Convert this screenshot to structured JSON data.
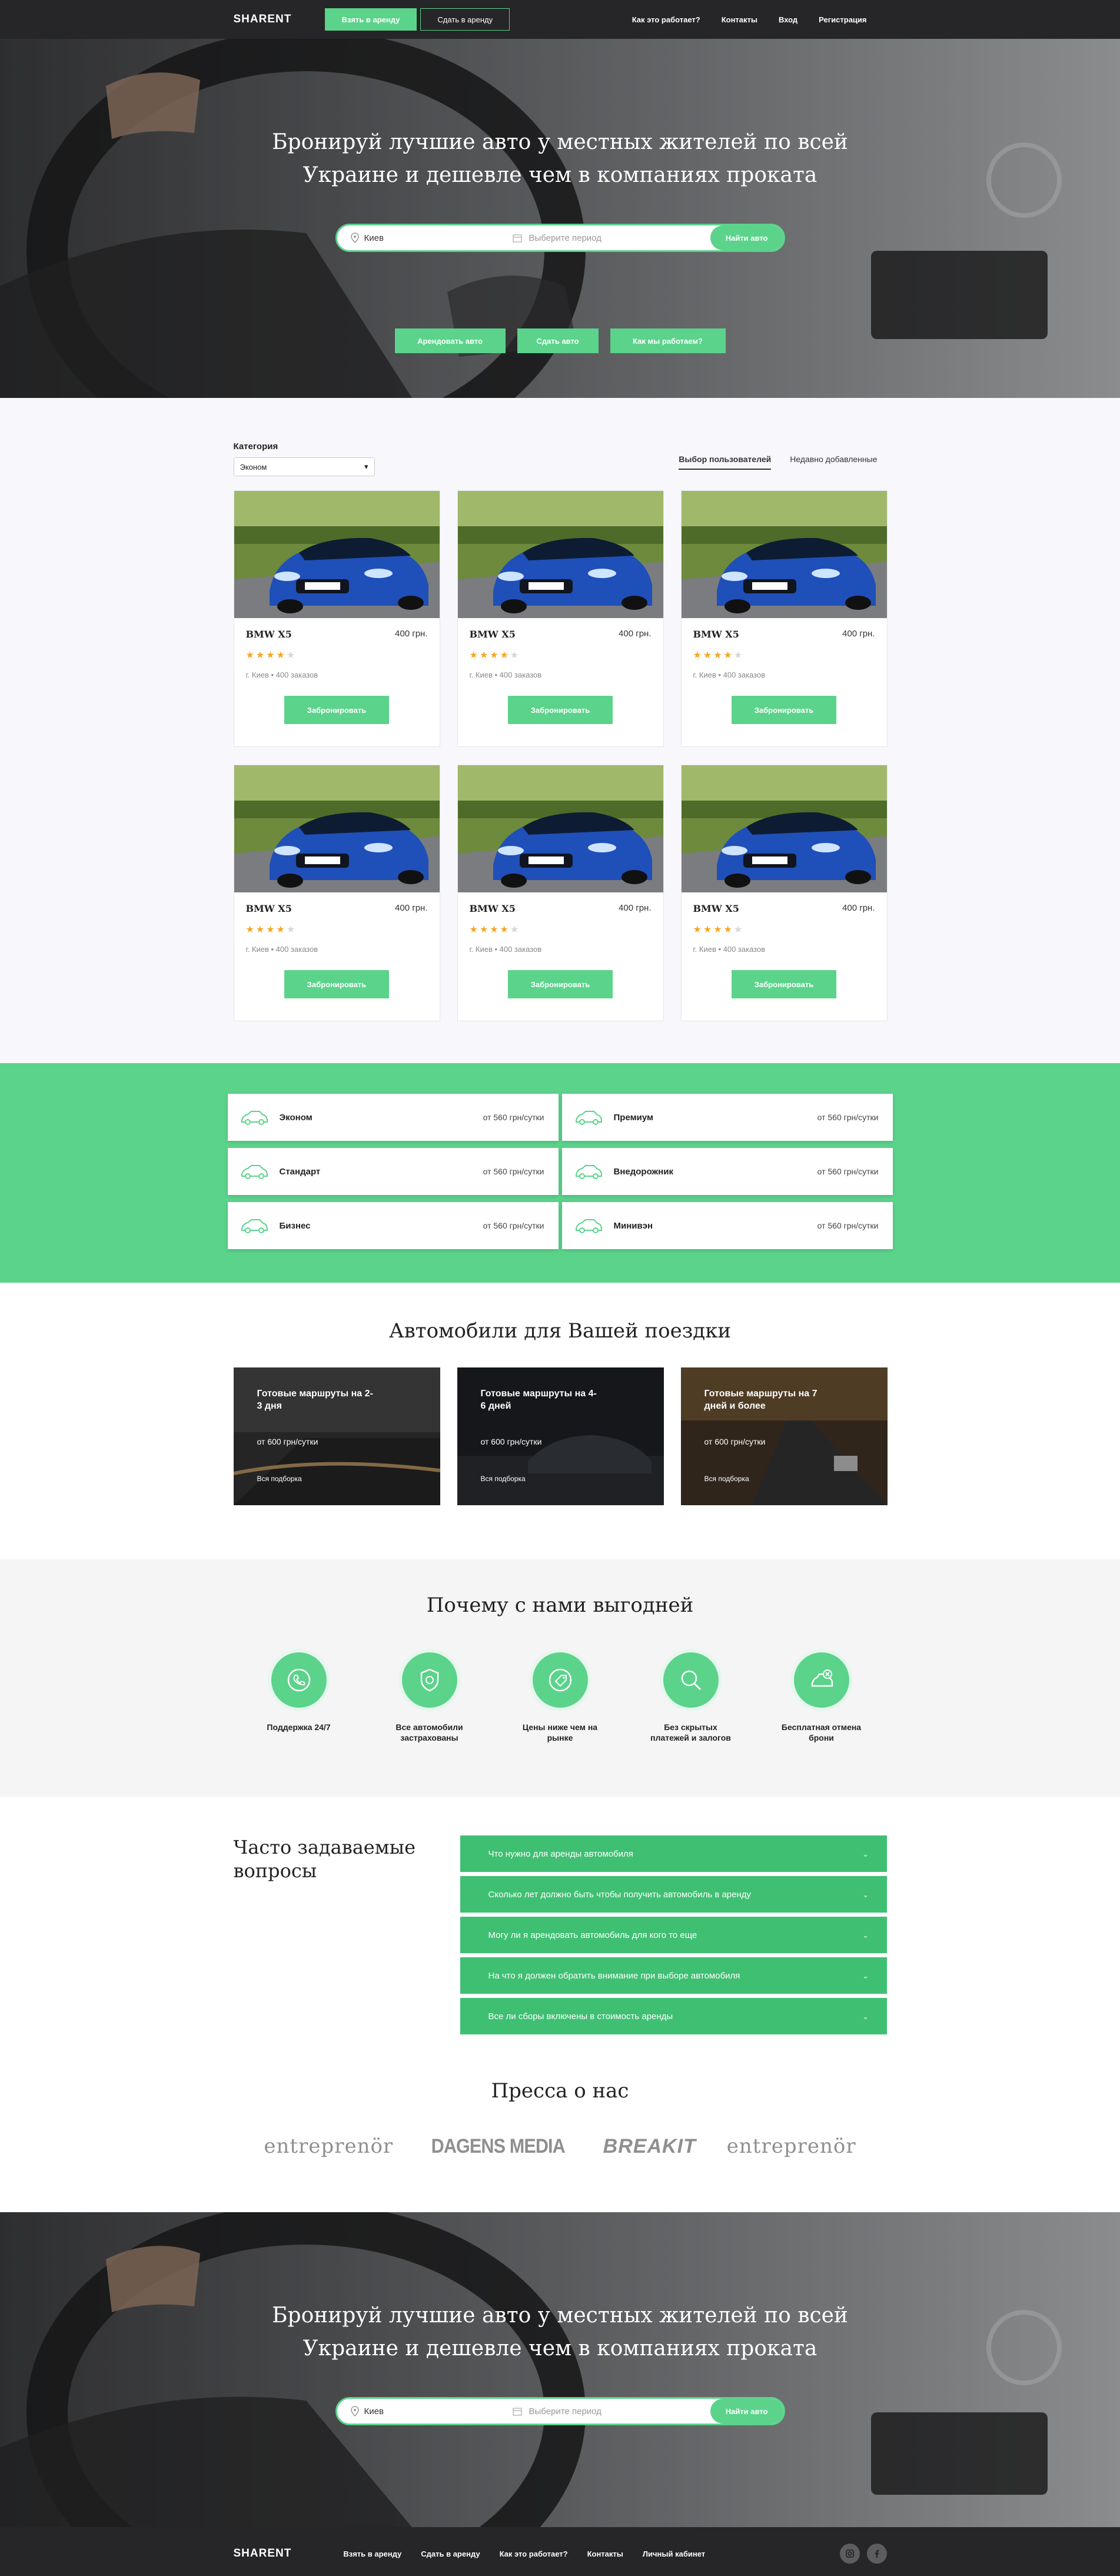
{
  "nav": {
    "logo": "SHARENT",
    "take_rent": "Взять в аренду",
    "give_rent": "Сдать в аренду",
    "links": [
      "Как это работает?",
      "Контакты",
      "Вход",
      "Регистрация"
    ]
  },
  "hero": {
    "title": "Бронируй лучшие авто у местных жителей по всей Украине и дешевле чем в компаниях проката",
    "city": "Киев",
    "period_placeholder": "Выберите период",
    "search_button": "Найти авто",
    "buttons": [
      "Арендовать авто",
      "Сдать авто",
      "Как мы работаем?"
    ]
  },
  "catalog": {
    "category_label": "Категория",
    "category_value": "Эконом",
    "tabs": [
      "Выбор пользователей",
      "Недавно добавленные"
    ],
    "cars": [
      {
        "name": "BMW X5",
        "price": "400 грн.",
        "rating": 4,
        "meta": "г. Киев • 400 заказов",
        "button": "Забронировать"
      },
      {
        "name": "BMW X5",
        "price": "400 грн.",
        "rating": 4,
        "meta": "г. Киев • 400 заказов",
        "button": "Забронировать"
      },
      {
        "name": "BMW X5",
        "price": "400 грн.",
        "rating": 4,
        "meta": "г. Киев • 400 заказов",
        "button": "Забронировать"
      },
      {
        "name": "BMW X5",
        "price": "400 грн.",
        "rating": 4,
        "meta": "г. Киев • 400 заказов",
        "button": "Забронировать"
      },
      {
        "name": "BMW X5",
        "price": "400 грн.",
        "rating": 4,
        "meta": "г. Киев • 400 заказов",
        "button": "Забронировать"
      },
      {
        "name": "BMW X5",
        "price": "400 грн.",
        "rating": 4,
        "meta": "г. Киев • 400 заказов",
        "button": "Забронировать"
      }
    ],
    "plate": "GENESIS"
  },
  "classes": [
    {
      "name": "Эконом",
      "price": "от 560 грн/сутки",
      "icon": "car-icon"
    },
    {
      "name": "Премиум",
      "price": "от 560 грн/сутки",
      "icon": "premium-car-icon"
    },
    {
      "name": "Стандарт",
      "price": "от 560 грн/сутки",
      "icon": "sedan-icon"
    },
    {
      "name": "Внедорожник",
      "price": "от 560 грн/сутки",
      "icon": "suv-icon"
    },
    {
      "name": "Бизнес",
      "price": "от 560 грн/сутки",
      "icon": "business-car-icon"
    },
    {
      "name": "Минивэн",
      "price": "от 560 грн/сутки",
      "icon": "minivan-icon"
    }
  ],
  "trips": {
    "title": "Автомобили для Вашей поездки",
    "items": [
      {
        "title": "Готовые маршруты на 2-3 дня",
        "price": "от 600 грн/сутки",
        "link": "Вся подборка"
      },
      {
        "title": "Готовые маршруты на 4-6 дней",
        "price": "от 600 грн/сутки",
        "link": "Вся подборка"
      },
      {
        "title": "Готовые маршруты на 7 дней и более",
        "price": "от 600 грн/сутки",
        "link": "Вся подборка"
      }
    ]
  },
  "why": {
    "title": "Почему с нами выгодней",
    "items": [
      {
        "text": "Поддержка 24/7",
        "icon": "support-phone-icon"
      },
      {
        "text": "Все автомобили застрахованы",
        "icon": "insurance-shield-icon"
      },
      {
        "text": "Цены ниже чем на рынке",
        "icon": "price-tag-icon"
      },
      {
        "text": "Без скрытых платежей и залогов",
        "icon": "search-icon"
      },
      {
        "text": "Бесплатная отмена брони",
        "icon": "cancel-car-icon"
      }
    ]
  },
  "faq": {
    "title": "Часто задаваемые вопросы",
    "items": [
      "Что нужно для аренды автомобиля",
      "Сколько лет должно быть чтобы получить автомобиль в аренду",
      "Могу ли я арендовать автомобиль для кого то еще",
      "На что я должен обратить внимание при выборе автомобиля",
      "Все ли сборы включены в стоимость аренды"
    ]
  },
  "press": {
    "title": "Пресса о нас",
    "logos": [
      "entreprenör",
      "DAGENS MEDIA",
      "BREAKIT",
      "entreprenör"
    ]
  },
  "footer": {
    "logo": "SHARENT",
    "links": [
      "Взять в аренду",
      "Сдать в аренду",
      "Как это работает?",
      "Контакты",
      "Личный кабинет"
    ],
    "socials": [
      "instagram-icon",
      "facebook-icon"
    ]
  },
  "colors": {
    "accent": "#5bd38b",
    "dark": "#262527",
    "faq": "#3fbf72"
  }
}
